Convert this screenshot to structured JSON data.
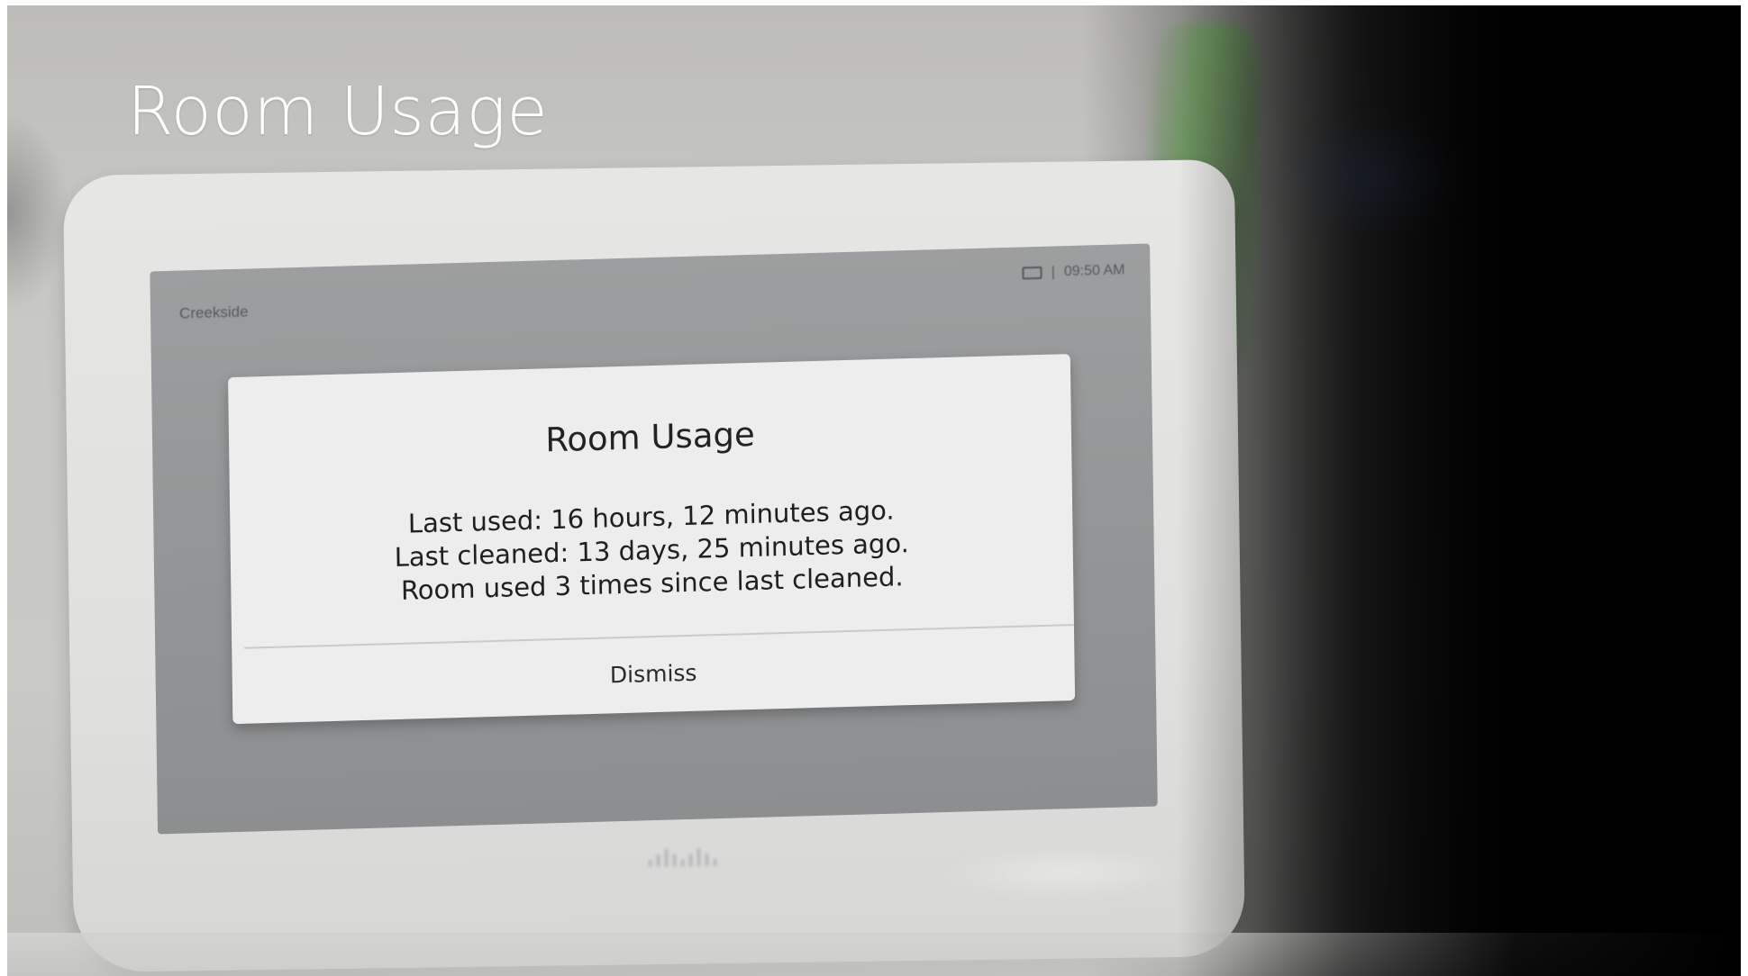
{
  "slide": {
    "title": "Room Usage"
  },
  "device": {
    "screen": {
      "room_name": "Creekside",
      "status": {
        "icon": "screen-share-icon",
        "separator": "|",
        "time": "09:50 AM"
      }
    },
    "dialog": {
      "title": "Room Usage",
      "lines": [
        "Last used: 16 hours, 12 minutes ago.",
        "Last cleaned: 13 days, 25 minutes ago.",
        "Room used 3 times since last cleaned."
      ],
      "dismiss_label": "Dismiss"
    },
    "logo": {
      "brand": "cisco"
    }
  },
  "colors": {
    "dialog_background": "#ecedec",
    "screen_background": "#959798",
    "title_text": "#ffffff"
  }
}
